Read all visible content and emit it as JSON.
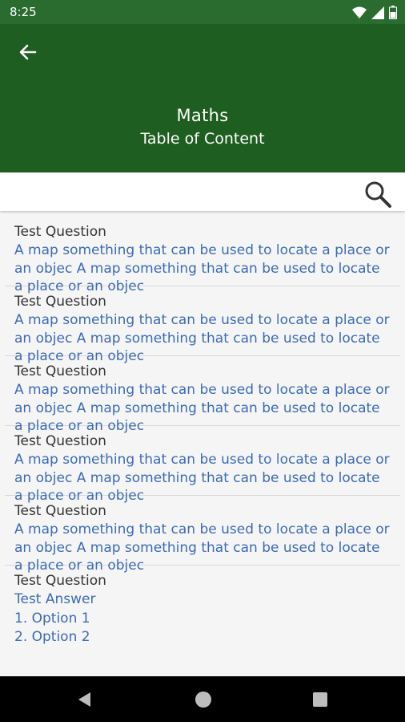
{
  "status_bar": {
    "time": "8:25"
  },
  "app_bar": {
    "title": "Maths",
    "subtitle": "Table of Content"
  },
  "search": {
    "placeholder": ""
  },
  "items": [
    {
      "question": "Test Question",
      "answer": "A map something that can be used to locate a place or an objec A map something that can be used to locate a place or an objec"
    },
    {
      "question": "Test Question",
      "answer": "A map something that can be used to locate a place or an objec A map something that can be used to locate a place or an objec"
    },
    {
      "question": "Test Question",
      "answer": "A map something that can be used to locate a place or an objec A map something that can be used to locate a place or an objec"
    },
    {
      "question": "Test Question",
      "answer": "A map something that can be used to locate a place or an objec A map something that can be used to locate a place or an objec"
    },
    {
      "question": "Test Question",
      "answer": "A map something that can be used to locate a place or an objec A map something that can be used to locate a place or an objec"
    }
  ],
  "last_item": {
    "question": "Test Question",
    "answer": "Test Answer",
    "option1": "1. Option 1",
    "option2": "2. Option 2"
  },
  "colors": {
    "status_bar": "#2a6b2f",
    "app_bar": "#1e5e20",
    "answer_text": "#3c6bb5"
  }
}
